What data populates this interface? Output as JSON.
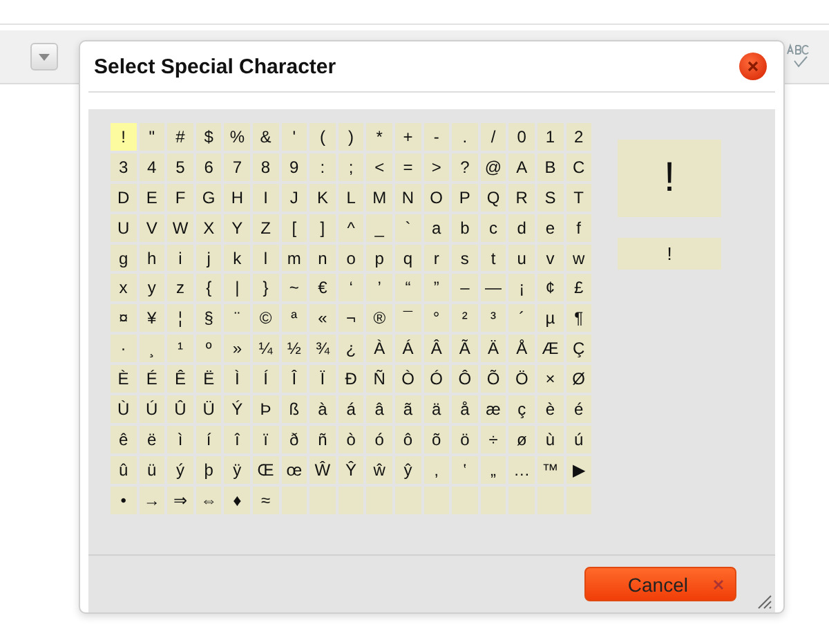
{
  "dialog": {
    "title": "Select Special Character"
  },
  "characters": [
    {
      "char": "!",
      "selected": true
    },
    {
      "char": "\"",
      "selected": false
    },
    {
      "char": "#",
      "selected": false
    },
    {
      "char": "$",
      "selected": false
    },
    {
      "char": "%",
      "selected": false
    },
    {
      "char": "&",
      "selected": false
    },
    {
      "char": "'",
      "selected": false
    },
    {
      "char": "(",
      "selected": false
    },
    {
      "char": ")",
      "selected": false
    },
    {
      "char": "*",
      "selected": false
    },
    {
      "char": "+",
      "selected": false
    },
    {
      "char": "-",
      "selected": false
    },
    {
      "char": ".",
      "selected": false
    },
    {
      "char": "/",
      "selected": false
    },
    {
      "char": "0",
      "selected": false
    },
    {
      "char": "1",
      "selected": false
    },
    {
      "char": "2",
      "selected": false
    },
    {
      "char": "3",
      "selected": false
    },
    {
      "char": "4",
      "selected": false
    },
    {
      "char": "5",
      "selected": false
    },
    {
      "char": "6",
      "selected": false
    },
    {
      "char": "7",
      "selected": false
    },
    {
      "char": "8",
      "selected": false
    },
    {
      "char": "9",
      "selected": false
    },
    {
      "char": ":",
      "selected": false
    },
    {
      "char": ";",
      "selected": false
    },
    {
      "char": "<",
      "selected": false
    },
    {
      "char": "=",
      "selected": false
    },
    {
      "char": ">",
      "selected": false
    },
    {
      "char": "?",
      "selected": false
    },
    {
      "char": "@",
      "selected": false
    },
    {
      "char": "A",
      "selected": false
    },
    {
      "char": "B",
      "selected": false
    },
    {
      "char": "C",
      "selected": false
    },
    {
      "char": "D",
      "selected": false
    },
    {
      "char": "E",
      "selected": false
    },
    {
      "char": "F",
      "selected": false
    },
    {
      "char": "G",
      "selected": false
    },
    {
      "char": "H",
      "selected": false
    },
    {
      "char": "I",
      "selected": false
    },
    {
      "char": "J",
      "selected": false
    },
    {
      "char": "K",
      "selected": false
    },
    {
      "char": "L",
      "selected": false
    },
    {
      "char": "M",
      "selected": false
    },
    {
      "char": "N",
      "selected": false
    },
    {
      "char": "O",
      "selected": false
    },
    {
      "char": "P",
      "selected": false
    },
    {
      "char": "Q",
      "selected": false
    },
    {
      "char": "R",
      "selected": false
    },
    {
      "char": "S",
      "selected": false
    },
    {
      "char": "T",
      "selected": false
    },
    {
      "char": "U",
      "selected": false
    },
    {
      "char": "V",
      "selected": false
    },
    {
      "char": "W",
      "selected": false
    },
    {
      "char": "X",
      "selected": false
    },
    {
      "char": "Y",
      "selected": false
    },
    {
      "char": "Z",
      "selected": false
    },
    {
      "char": "[",
      "selected": false
    },
    {
      "char": "]",
      "selected": false
    },
    {
      "char": "^",
      "selected": false
    },
    {
      "char": "_",
      "selected": false
    },
    {
      "char": "`",
      "selected": false
    },
    {
      "char": "a",
      "selected": false
    },
    {
      "char": "b",
      "selected": false
    },
    {
      "char": "c",
      "selected": false
    },
    {
      "char": "d",
      "selected": false
    },
    {
      "char": "e",
      "selected": false
    },
    {
      "char": "f",
      "selected": false
    },
    {
      "char": "g",
      "selected": false
    },
    {
      "char": "h",
      "selected": false
    },
    {
      "char": "i",
      "selected": false
    },
    {
      "char": "j",
      "selected": false
    },
    {
      "char": "k",
      "selected": false
    },
    {
      "char": "l",
      "selected": false
    },
    {
      "char": "m",
      "selected": false
    },
    {
      "char": "n",
      "selected": false
    },
    {
      "char": "o",
      "selected": false
    },
    {
      "char": "p",
      "selected": false
    },
    {
      "char": "q",
      "selected": false
    },
    {
      "char": "r",
      "selected": false
    },
    {
      "char": "s",
      "selected": false
    },
    {
      "char": "t",
      "selected": false
    },
    {
      "char": "u",
      "selected": false
    },
    {
      "char": "v",
      "selected": false
    },
    {
      "char": "w",
      "selected": false
    },
    {
      "char": "x",
      "selected": false
    },
    {
      "char": "y",
      "selected": false
    },
    {
      "char": "z",
      "selected": false
    },
    {
      "char": "{",
      "selected": false
    },
    {
      "char": "|",
      "selected": false
    },
    {
      "char": "}",
      "selected": false
    },
    {
      "char": "~",
      "selected": false
    },
    {
      "char": "€",
      "selected": false
    },
    {
      "char": "‘",
      "selected": false
    },
    {
      "char": "’",
      "selected": false
    },
    {
      "char": "“",
      "selected": false
    },
    {
      "char": "”",
      "selected": false
    },
    {
      "char": "–",
      "selected": false
    },
    {
      "char": "—",
      "selected": false
    },
    {
      "char": "¡",
      "selected": false
    },
    {
      "char": "¢",
      "selected": false
    },
    {
      "char": "£",
      "selected": false
    },
    {
      "char": "¤",
      "selected": false
    },
    {
      "char": "¥",
      "selected": false
    },
    {
      "char": "¦",
      "selected": false
    },
    {
      "char": "§",
      "selected": false
    },
    {
      "char": "¨",
      "selected": false
    },
    {
      "char": "©",
      "selected": false
    },
    {
      "char": "ª",
      "selected": false
    },
    {
      "char": "«",
      "selected": false
    },
    {
      "char": "¬",
      "selected": false
    },
    {
      "char": "®",
      "selected": false
    },
    {
      "char": "¯",
      "selected": false
    },
    {
      "char": "°",
      "selected": false
    },
    {
      "char": "²",
      "selected": false
    },
    {
      "char": "³",
      "selected": false
    },
    {
      "char": "´",
      "selected": false
    },
    {
      "char": "µ",
      "selected": false
    },
    {
      "char": "¶",
      "selected": false
    },
    {
      "char": "·",
      "selected": false
    },
    {
      "char": "¸",
      "selected": false
    },
    {
      "char": "¹",
      "selected": false
    },
    {
      "char": "º",
      "selected": false
    },
    {
      "char": "»",
      "selected": false
    },
    {
      "char": "¼",
      "selected": false
    },
    {
      "char": "½",
      "selected": false
    },
    {
      "char": "¾",
      "selected": false
    },
    {
      "char": "¿",
      "selected": false
    },
    {
      "char": "À",
      "selected": false
    },
    {
      "char": "Á",
      "selected": false
    },
    {
      "char": "Â",
      "selected": false
    },
    {
      "char": "Ã",
      "selected": false
    },
    {
      "char": "Ä",
      "selected": false
    },
    {
      "char": "Å",
      "selected": false
    },
    {
      "char": "Æ",
      "selected": false
    },
    {
      "char": "Ç",
      "selected": false
    },
    {
      "char": "È",
      "selected": false
    },
    {
      "char": "É",
      "selected": false
    },
    {
      "char": "Ê",
      "selected": false
    },
    {
      "char": "Ë",
      "selected": false
    },
    {
      "char": "Ì",
      "selected": false
    },
    {
      "char": "Í",
      "selected": false
    },
    {
      "char": "Î",
      "selected": false
    },
    {
      "char": "Ï",
      "selected": false
    },
    {
      "char": "Ð",
      "selected": false
    },
    {
      "char": "Ñ",
      "selected": false
    },
    {
      "char": "Ò",
      "selected": false
    },
    {
      "char": "Ó",
      "selected": false
    },
    {
      "char": "Ô",
      "selected": false
    },
    {
      "char": "Õ",
      "selected": false
    },
    {
      "char": "Ö",
      "selected": false
    },
    {
      "char": "×",
      "selected": false
    },
    {
      "char": "Ø",
      "selected": false
    },
    {
      "char": "Ù",
      "selected": false
    },
    {
      "char": "Ú",
      "selected": false
    },
    {
      "char": "Û",
      "selected": false
    },
    {
      "char": "Ü",
      "selected": false
    },
    {
      "char": "Ý",
      "selected": false
    },
    {
      "char": "Þ",
      "selected": false
    },
    {
      "char": "ß",
      "selected": false
    },
    {
      "char": "à",
      "selected": false
    },
    {
      "char": "á",
      "selected": false
    },
    {
      "char": "â",
      "selected": false
    },
    {
      "char": "ã",
      "selected": false
    },
    {
      "char": "ä",
      "selected": false
    },
    {
      "char": "å",
      "selected": false
    },
    {
      "char": "æ",
      "selected": false
    },
    {
      "char": "ç",
      "selected": false
    },
    {
      "char": "è",
      "selected": false
    },
    {
      "char": "é",
      "selected": false
    },
    {
      "char": "ê",
      "selected": false
    },
    {
      "char": "ë",
      "selected": false
    },
    {
      "char": "ì",
      "selected": false
    },
    {
      "char": "í",
      "selected": false
    },
    {
      "char": "î",
      "selected": false
    },
    {
      "char": "ï",
      "selected": false
    },
    {
      "char": "ð",
      "selected": false
    },
    {
      "char": "ñ",
      "selected": false
    },
    {
      "char": "ò",
      "selected": false
    },
    {
      "char": "ó",
      "selected": false
    },
    {
      "char": "ô",
      "selected": false
    },
    {
      "char": "õ",
      "selected": false
    },
    {
      "char": "ö",
      "selected": false
    },
    {
      "char": "÷",
      "selected": false
    },
    {
      "char": "ø",
      "selected": false
    },
    {
      "char": "ù",
      "selected": false
    },
    {
      "char": "ú",
      "selected": false
    },
    {
      "char": "û",
      "selected": false
    },
    {
      "char": "ü",
      "selected": false
    },
    {
      "char": "ý",
      "selected": false
    },
    {
      "char": "þ",
      "selected": false
    },
    {
      "char": "ÿ",
      "selected": false
    },
    {
      "char": "Œ",
      "selected": false
    },
    {
      "char": "œ",
      "selected": false
    },
    {
      "char": "Ŵ",
      "selected": false
    },
    {
      "char": "Ŷ",
      "selected": false
    },
    {
      "char": "ŵ",
      "selected": false
    },
    {
      "char": "ŷ",
      "selected": false
    },
    {
      "char": "‚",
      "selected": false
    },
    {
      "char": "‛",
      "selected": false
    },
    {
      "char": "„",
      "selected": false
    },
    {
      "char": "…",
      "selected": false
    },
    {
      "char": "™",
      "selected": false
    },
    {
      "char": "▶",
      "selected": false
    },
    {
      "char": "•",
      "selected": false
    },
    {
      "char": "→",
      "selected": false
    },
    {
      "char": "⇒",
      "selected": false
    },
    {
      "char": "⇔",
      "selected": false
    },
    {
      "char": "♦",
      "selected": false
    },
    {
      "char": "≈",
      "selected": false
    }
  ],
  "preview": {
    "large": "!",
    "small": "!"
  },
  "cancel_button": {
    "label": "Cancel"
  }
}
